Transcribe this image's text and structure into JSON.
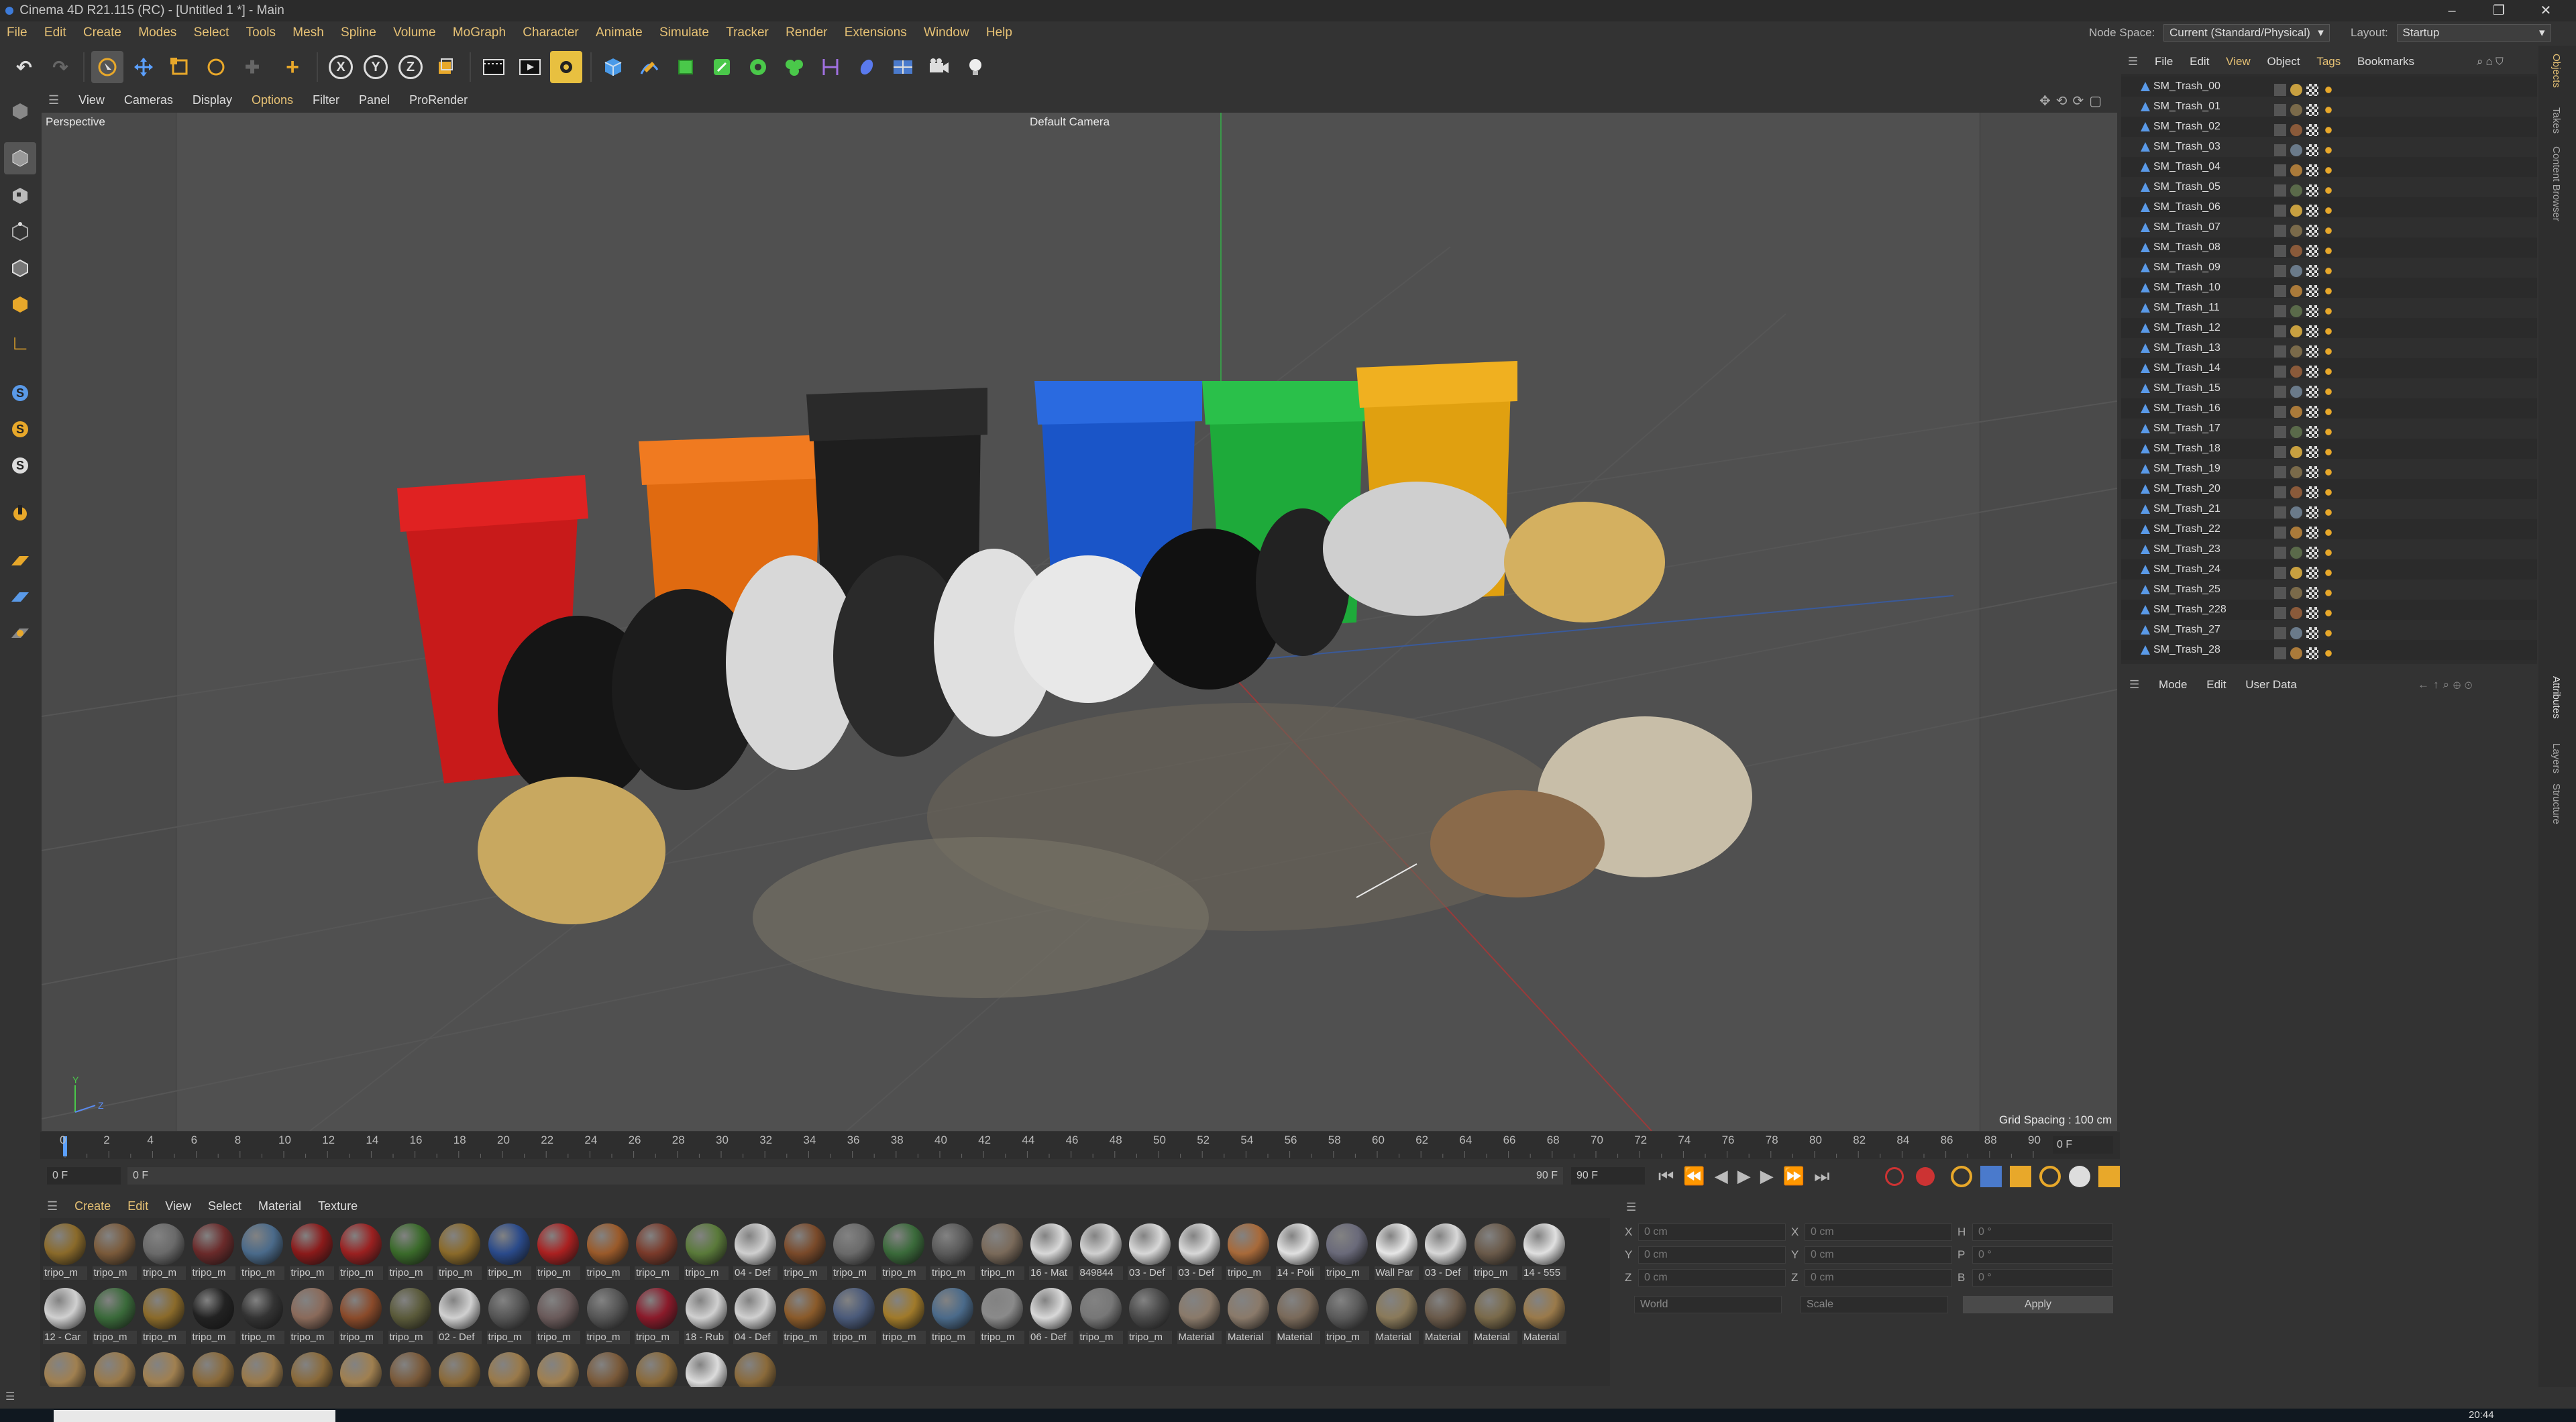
{
  "window": {
    "title": "Cinema 4D R21.115 (RC) - [Untitled 1 *] - Main",
    "controls": [
      "–",
      "❐",
      "✕"
    ]
  },
  "menubar": {
    "items": [
      "File",
      "Edit",
      "Create",
      "Modes",
      "Select",
      "Tools",
      "Mesh",
      "Spline",
      "Volume",
      "MoGraph",
      "Character",
      "Animate",
      "Simulate",
      "Tracker",
      "Render",
      "Extensions",
      "Window",
      "Help"
    ],
    "node_space_label": "Node Space:",
    "node_space_value": "Current (Standard/Physical)",
    "layout_label": "Layout:",
    "layout_value": "Startup"
  },
  "toolbar": {
    "axis_x": "X",
    "axis_y": "Y",
    "axis_z": "Z"
  },
  "viewport": {
    "menu": [
      "View",
      "Cameras",
      "Display",
      "Options",
      "Filter",
      "Panel",
      "ProRender"
    ],
    "view_name": "Perspective",
    "camera": "Default Camera",
    "grid_spacing": "Grid Spacing : 100 cm",
    "axis_y": "Y",
    "axis_z": "Z"
  },
  "timeline": {
    "ticks": [
      "0",
      "2",
      "4",
      "6",
      "8",
      "10",
      "12",
      "14",
      "16",
      "18",
      "20",
      "22",
      "24",
      "26",
      "28",
      "30",
      "32",
      "34",
      "36",
      "38",
      "40",
      "42",
      "44",
      "46",
      "48",
      "50",
      "52",
      "54",
      "56",
      "58",
      "60",
      "62",
      "64",
      "66",
      "68",
      "70",
      "72",
      "74",
      "76",
      "78",
      "80",
      "82",
      "84",
      "86",
      "88",
      "90"
    ],
    "current_frame_right": "0 F",
    "start_frame": "0 F",
    "preview_start": "0 F",
    "preview_end": "90 F",
    "end_frame": "90 F"
  },
  "material_manager": {
    "menu": [
      "Create",
      "Edit",
      "View",
      "Select",
      "Material",
      "Texture"
    ],
    "row1": [
      "tripo_m",
      "tripo_m",
      "tripo_m",
      "tripo_m",
      "tripo_m",
      "tripo_m",
      "tripo_m",
      "tripo_m",
      "tripo_m",
      "tripo_m",
      "tripo_m",
      "tripo_m",
      "tripo_m",
      "tripo_m",
      "04 - Def",
      "tripo_m",
      "tripo_m",
      "tripo_m",
      "tripo_m",
      "tripo_m",
      "16 - Mat",
      "849844",
      "03 - Def",
      "03 - Def",
      "tripo_m",
      "14 - Poli",
      "tripo_m",
      "Wall Par",
      "03 - Def",
      "tripo_m",
      "14 - 555"
    ],
    "row2": [
      "12 - Car",
      "tripo_m",
      "tripo_m",
      "tripo_m",
      "tripo_m",
      "tripo_m",
      "tripo_m",
      "tripo_m",
      "02 - Def",
      "tripo_m",
      "tripo_m",
      "tripo_m",
      "tripo_m",
      "18 - Rub",
      "04 - Def",
      "tripo_m",
      "tripo_m",
      "tripo_m",
      "tripo_m",
      "tripo_m",
      "06 - Def",
      "tripo_m",
      "tripo_m",
      "Material",
      "Material",
      "Material",
      "tripo_m",
      "Material",
      "Material",
      "Material",
      "Material"
    ],
    "row1_colors": [
      "#8a6a2a",
      "#7a5a3a",
      "#6a6a6a",
      "#6a2a2a",
      "#4a6a8a",
      "#8a1a1a",
      "#9a2020",
      "#3a6a2a",
      "#8a6a2a",
      "#2a4a8a",
      "#aa2020",
      "#9a5a2a",
      "#7a3a2a",
      "#5a7a3a",
      "#cfcfcf",
      "#7a4a2a",
      "#6a6a6a",
      "#3a6a3a",
      "#5a5a5a",
      "#7a6a5a",
      "#d8d8d8",
      "#d0d0d0",
      "#d8d8d8",
      "#d8d8d8",
      "#a86a3a",
      "#e0e0e0",
      "#6a6a7a",
      "#e6e6e6",
      "#d8d8d8",
      "#6a5a4a",
      "#e0e0e0"
    ],
    "row2_colors": [
      "#d0d0d0",
      "#3a6a3a",
      "#8a6a2a",
      "#222222",
      "#333333",
      "#8a6a5a",
      "#8a4a2a",
      "#5a5a3a",
      "#d0d0d0",
      "#555555",
      "#6a5a5a",
      "#555555",
      "#8a1a2a",
      "#d0d0d0",
      "#d0d0d0",
      "#8a5a2a",
      "#4a5a7a",
      "#a07a2a",
      "#4a6a8a",
      "#8a8a8a",
      "#d8d8d8",
      "#777777",
      "#4a4a4a",
      "#8a7a6a",
      "#8a7a6a",
      "#7a6a5a",
      "#5a5a5a",
      "#8a7a5a",
      "#6a5a4a",
      "#7a6a4a",
      "#9a7a4a"
    ],
    "row3_colors": [
      "#a08050",
      "#9a7a4a",
      "#a08050",
      "#8a6a3a",
      "#9a7a4a",
      "#8a6a3a",
      "#a08050",
      "#7a5a3a",
      "#8a6a3a",
      "#9a7a4a",
      "#a08050",
      "#7a5a3a",
      "#8a6a3a",
      "#dcdcdc",
      "#8a6a3a"
    ]
  },
  "coordinates": {
    "x_label": "X",
    "y_label": "Y",
    "z_label": "Z",
    "x_pos": "0 cm",
    "y_pos": "0 cm",
    "z_pos": "0 cm",
    "x_size": "0 cm",
    "y_size": "0 cm",
    "z_size": "0 cm",
    "h_label": "H",
    "p_label": "P",
    "b_label": "B",
    "h_val": "0 °",
    "p_val": "0 °",
    "b_val": "0 °",
    "mode_world": "World",
    "mode_scale": "Scale",
    "apply": "Apply"
  },
  "object_manager": {
    "menu": [
      "File",
      "Edit",
      "View",
      "Object",
      "Tags",
      "Bookmarks"
    ],
    "objects": [
      "SM_Trash_00",
      "SM_Trash_01",
      "SM_Trash_02",
      "SM_Trash_03",
      "SM_Trash_04",
      "SM_Trash_05",
      "SM_Trash_06",
      "SM_Trash_07",
      "SM_Trash_08",
      "SM_Trash_09",
      "SM_Trash_10",
      "SM_Trash_11",
      "SM_Trash_12",
      "SM_Trash_13",
      "SM_Trash_14",
      "SM_Trash_15",
      "SM_Trash_16",
      "SM_Trash_17",
      "SM_Trash_18",
      "SM_Trash_19",
      "SM_Trash_20",
      "SM_Trash_21",
      "SM_Trash_22",
      "SM_Trash_23",
      "SM_Trash_24",
      "SM_Trash_25",
      "SM_Trash_228",
      "SM_Trash_27",
      "SM_Trash_28"
    ]
  },
  "attributes": {
    "menu": [
      "Mode",
      "Edit",
      "User Data"
    ]
  },
  "right_tabs": [
    "Objects",
    "Takes",
    "Content Browser",
    "Attributes",
    "Layers",
    "Structure"
  ],
  "status": {
    "clock": "20:44"
  }
}
